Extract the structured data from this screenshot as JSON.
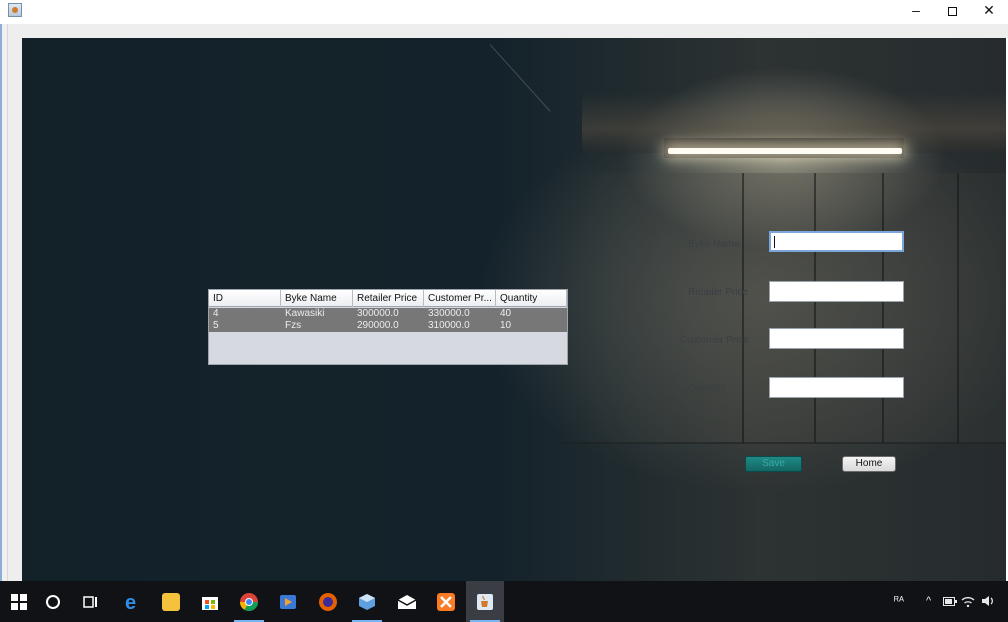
{
  "window": {
    "min_glyph": "–",
    "close_glyph": "✕"
  },
  "table": {
    "columns": [
      "ID",
      "Byke Name",
      "Retailer Price",
      "Customer Pr...",
      "Quantity"
    ],
    "rows": [
      [
        "4",
        "Kawasiki",
        "300000.0",
        "330000.0",
        "40"
      ],
      [
        "5",
        "Fzs",
        "290000.0",
        "310000.0",
        "10"
      ]
    ]
  },
  "form": {
    "byke_name_label": "Byke Name",
    "retailer_price_label": "Retailer Price",
    "customer_price_label": "Customer Price",
    "quantity_label": "Quantity",
    "byke_name_value": "",
    "retailer_price_value": "",
    "customer_price_value": "",
    "quantity_value": "",
    "save_label": "Save",
    "home_label": "Home"
  },
  "taskbar": {
    "tray_text": "ᴿᴬ",
    "tray_chevron": "^"
  },
  "colors": {
    "save_button": "#1a7b77",
    "taskbar": "#101216",
    "table_row": "#777777"
  }
}
